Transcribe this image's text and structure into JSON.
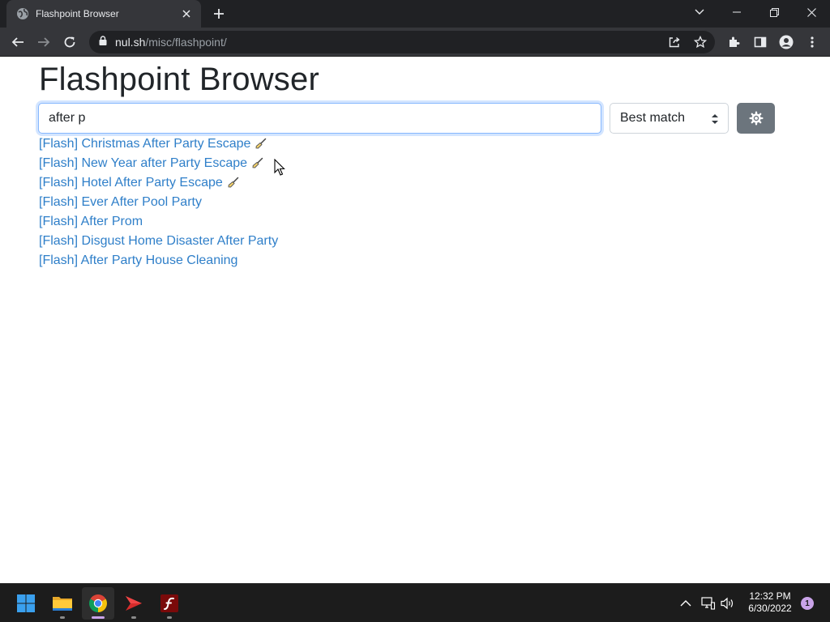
{
  "browser": {
    "tab_title": "Flashpoint Browser",
    "url_host": "nul.sh",
    "url_path": "/misc/flashpoint/"
  },
  "page": {
    "title": "Flashpoint Browser",
    "search": {
      "value": "after p"
    },
    "sort": {
      "selected": "Best match"
    },
    "results": [
      {
        "label": "[Flash] Christmas After Party Escape",
        "broom": true
      },
      {
        "label": "[Flash] New Year after Party Escape",
        "broom": true
      },
      {
        "label": "[Flash] Hotel After Party Escape",
        "broom": true
      },
      {
        "label": "[Flash] Ever After Pool Party",
        "broom": false
      },
      {
        "label": "[Flash] After Prom",
        "broom": false
      },
      {
        "label": "[Flash] Disgust Home Disaster After Party",
        "broom": false
      },
      {
        "label": "[Flash] After Party House Cleaning",
        "broom": false
      }
    ]
  },
  "taskbar": {
    "time": "12:32 PM",
    "date": "6/30/2022",
    "notification_count": "1",
    "apps": [
      "windows-start-icon",
      "file-explorer-icon",
      "chrome-icon",
      "flashpoint-launcher-icon",
      "flash-player-icon"
    ]
  },
  "colors": {
    "link": "#2f7fc9",
    "settings_button": "#6c757d",
    "chrome_dark": "#202124",
    "chrome_toolbar": "#35363a",
    "taskbar": "#1c1c1c"
  }
}
